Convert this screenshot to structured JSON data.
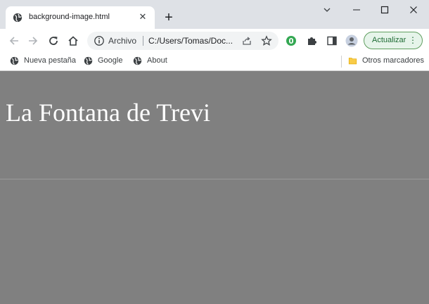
{
  "tab": {
    "title": "background-image.html",
    "close": "✕"
  },
  "new_tab": "+",
  "window_controls": {
    "dropdown": "⌄",
    "minimize": "–",
    "maximize": "☐",
    "close": "✕"
  },
  "toolbar": {
    "back": "←",
    "forward": "→",
    "reload": "C",
    "home": "⌂"
  },
  "omnibox": {
    "label": "Archivo",
    "url": "C:/Users/Tomas/Doc..."
  },
  "update_button": {
    "label": "Actualizar",
    "menu": "⋮"
  },
  "bookmarks": [
    {
      "label": "Nueva pestaña",
      "icon": "globe-icon"
    },
    {
      "label": "Google",
      "icon": "globe-icon"
    },
    {
      "label": "About",
      "icon": "globe-icon"
    }
  ],
  "other_bookmarks": {
    "label": "Otros marcadores",
    "icon": "folder-icon"
  },
  "page": {
    "heading": "La Fontana de Trevi",
    "background": "#808080"
  },
  "colors": {
    "accent_green": "#1e6b34",
    "chrome_bg": "#dee1e6"
  }
}
